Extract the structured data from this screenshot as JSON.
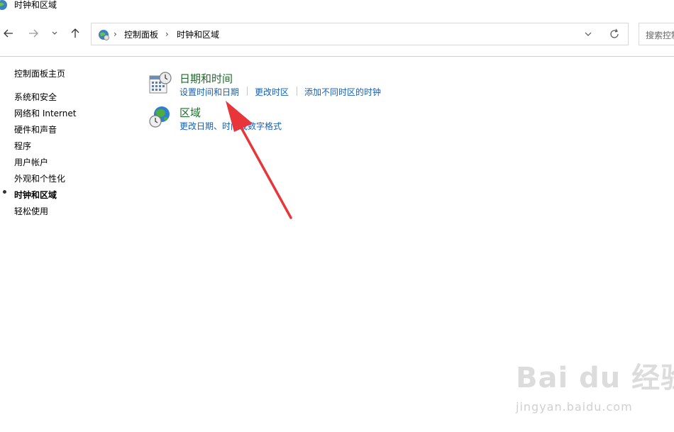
{
  "window": {
    "title": "时钟和区域"
  },
  "nav": {
    "breadcrumbs": [
      "控制面板",
      "时钟和区域"
    ],
    "search_placeholder": "搜索控制"
  },
  "sidebar": {
    "items": [
      {
        "label": "控制面板主页"
      },
      {
        "label": "系统和安全"
      },
      {
        "label": "网络和 Internet"
      },
      {
        "label": "硬件和声音"
      },
      {
        "label": "程序"
      },
      {
        "label": "用户帐户"
      },
      {
        "label": "外观和个性化"
      },
      {
        "label": "时钟和区域",
        "active": true
      },
      {
        "label": "轻松使用"
      }
    ]
  },
  "categories": [
    {
      "title": "日期和时间",
      "icon": "calendar-clock-icon",
      "links": [
        "设置时间和日期",
        "更改时区",
        "添加不同时区的时钟"
      ]
    },
    {
      "title": "区域",
      "icon": "globe-clock-icon",
      "links": [
        "更改日期、时间或数字格式"
      ]
    }
  ],
  "annotation": {
    "type": "red-arrow",
    "color": "#e8353a"
  },
  "watermark": {
    "main": "Bai du 经验",
    "sub": "jingyan.baidu.com"
  },
  "colors": {
    "category_title": "#1e6b2b",
    "link": "#1a5fb4",
    "arrow": "#e8353a"
  }
}
